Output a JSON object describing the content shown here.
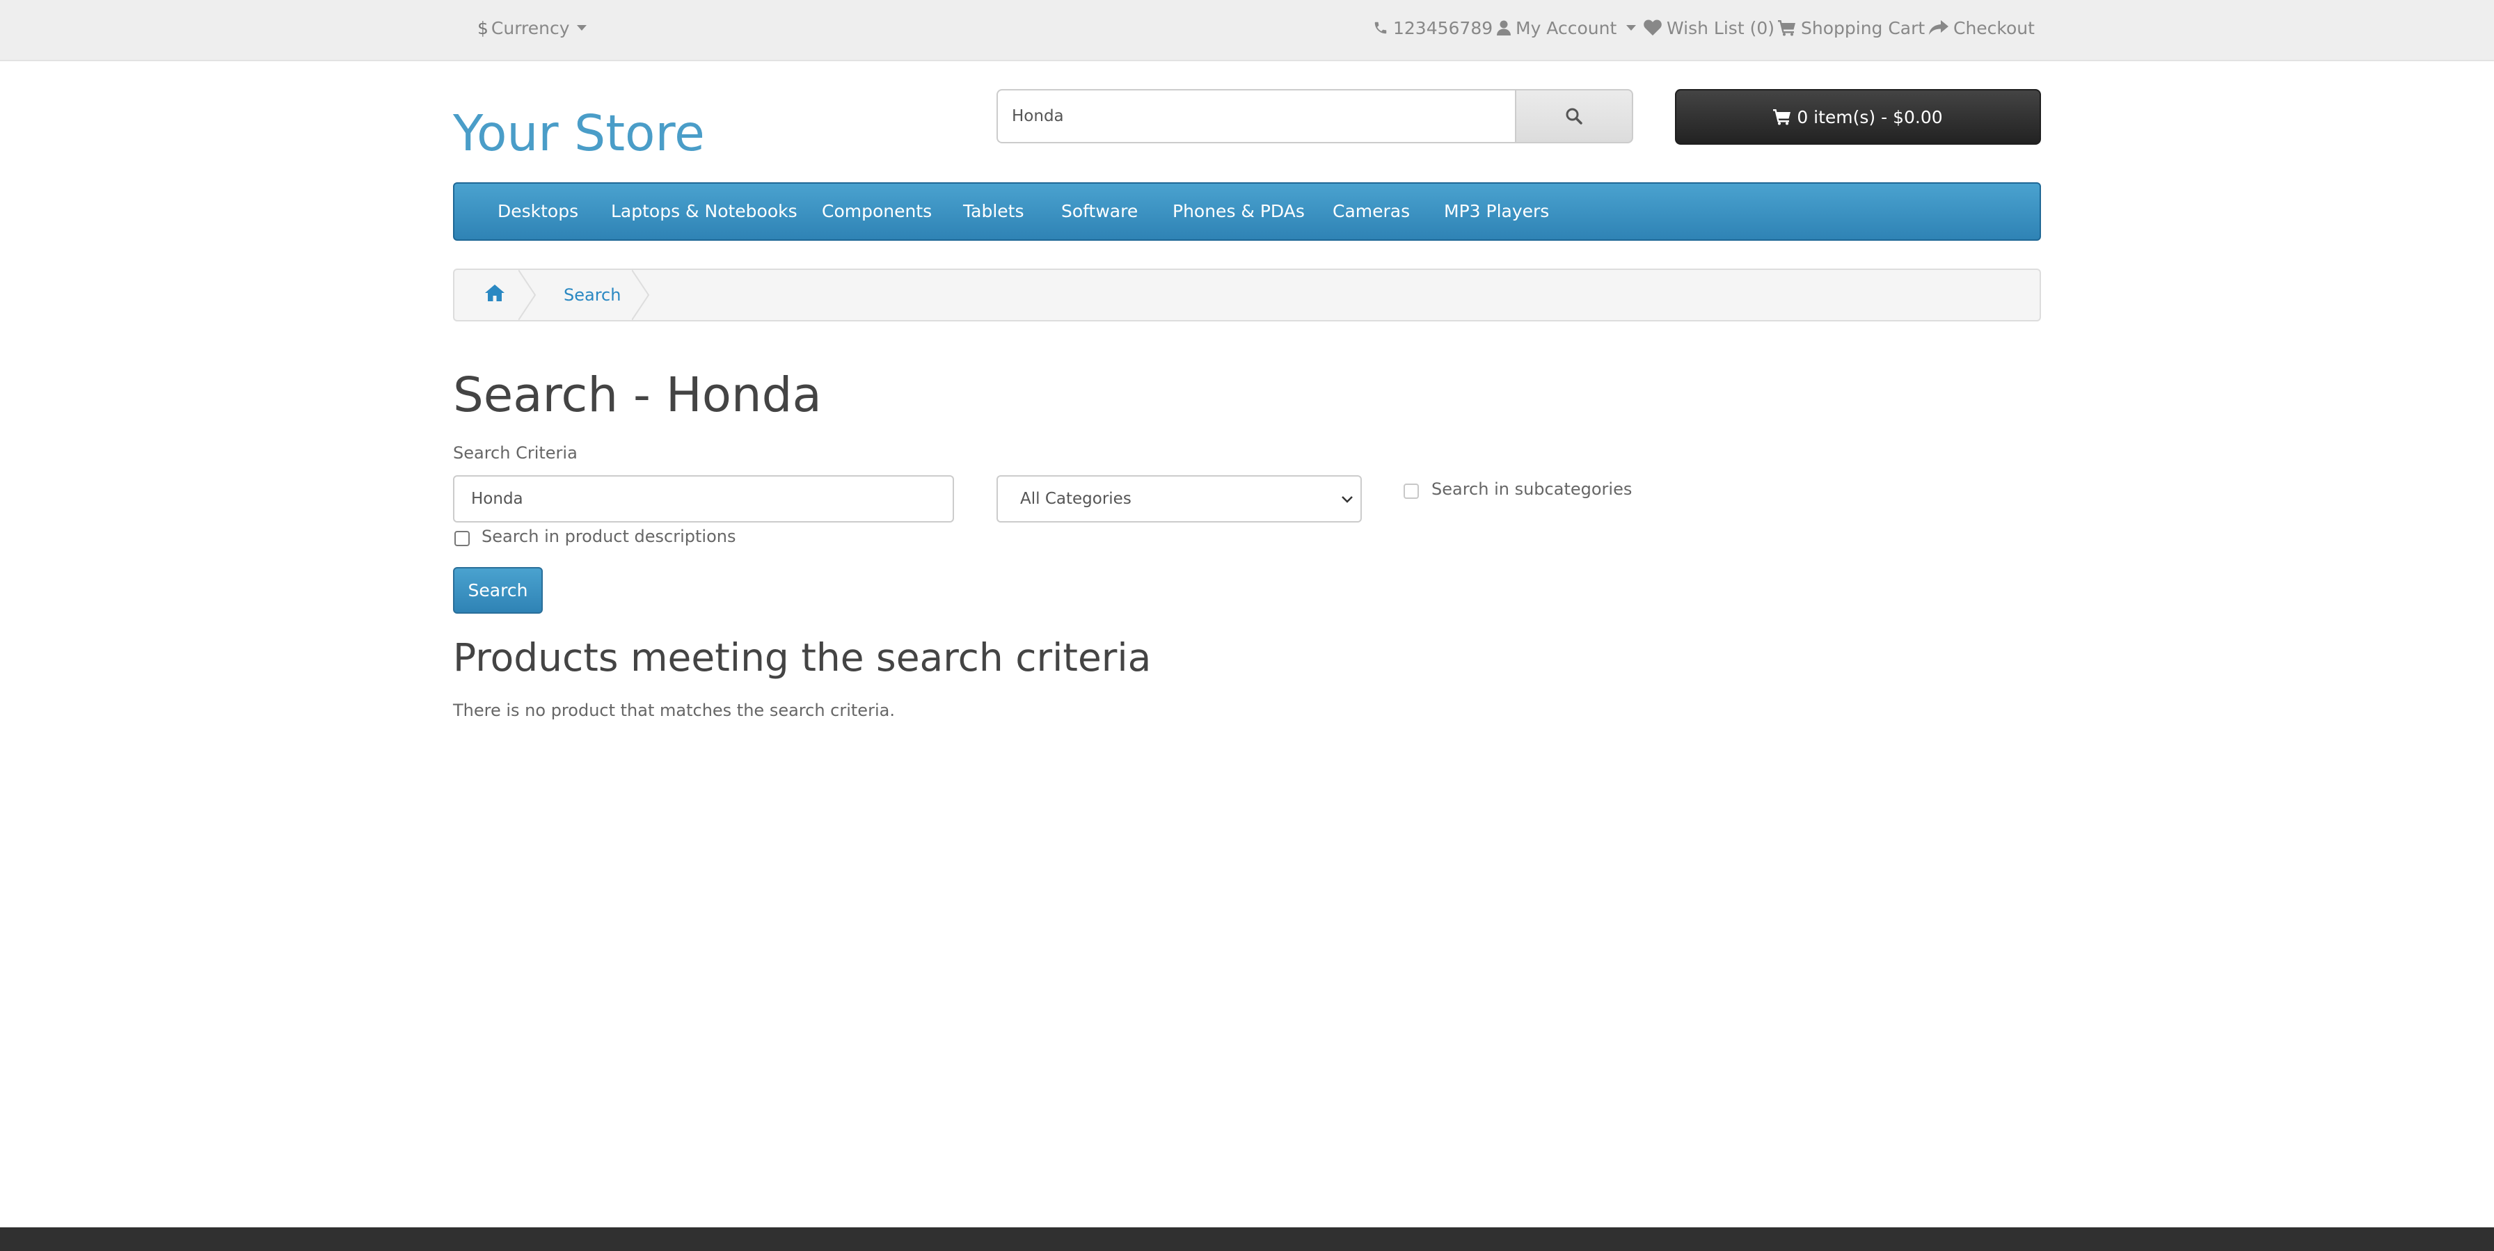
{
  "top_bar": {
    "currency_symbol": "$",
    "currency_label": "Currency",
    "phone": "123456789",
    "my_account": "My Account",
    "wish_list": "Wish List (0)",
    "shopping_cart": "Shopping Cart",
    "checkout": "Checkout"
  },
  "header": {
    "logo": "Your Store",
    "search_value": "Honda",
    "cart_label": "0 item(s) - $0.00"
  },
  "menu": {
    "items": [
      "Desktops",
      "Laptops & Notebooks",
      "Components",
      "Tablets",
      "Software",
      "Phones & PDAs",
      "Cameras",
      "MP3 Players"
    ]
  },
  "breadcrumb": {
    "search": "Search"
  },
  "main": {
    "title": "Search - Honda",
    "criteria_label": "Search Criteria",
    "keyword_value": "Honda",
    "category_selected": "All Categories",
    "subcategories_label": "Search in subcategories",
    "descriptions_label": "Search in product descriptions",
    "search_button": "Search",
    "results_heading": "Products meeting the search criteria",
    "no_results": "There is no product that matches the search criteria."
  },
  "colors": {
    "accent": "#2f83b5",
    "logo": "#4a9dc8",
    "cart_button": "#333333",
    "footer": "#303030"
  }
}
